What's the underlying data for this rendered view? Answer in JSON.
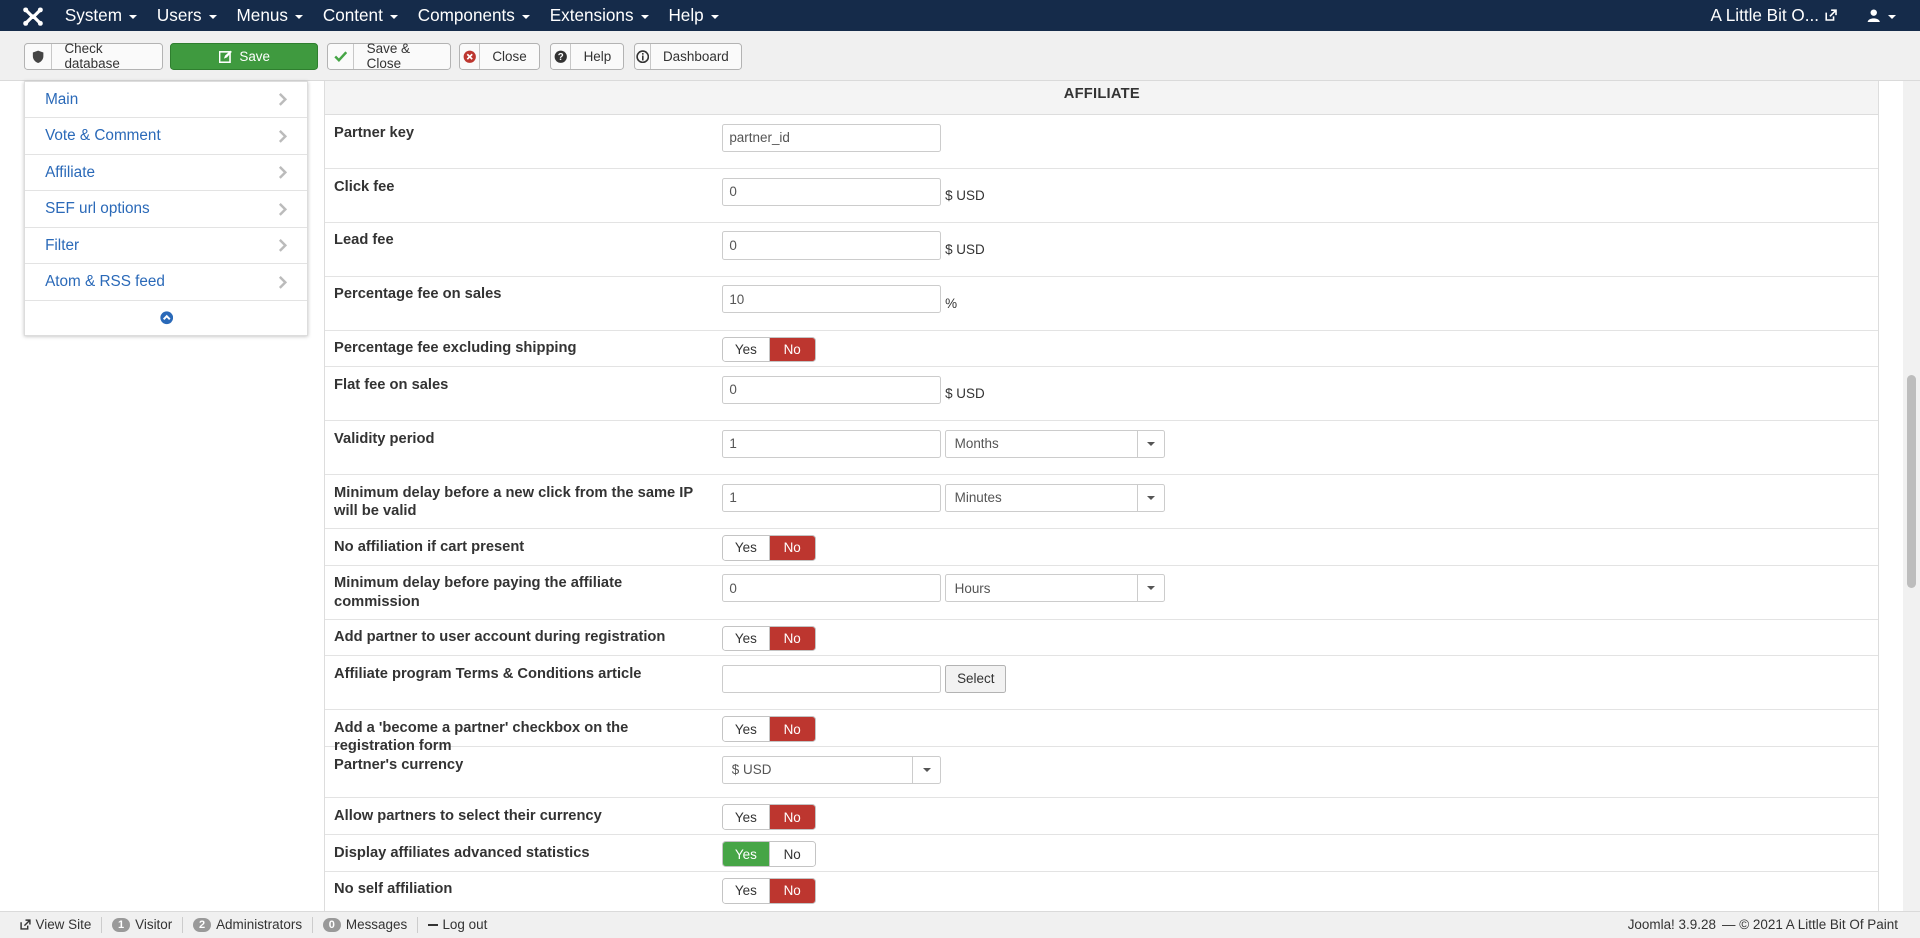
{
  "navbar": {
    "menu": [
      "System",
      "Users",
      "Menus",
      "Content",
      "Components",
      "Extensions",
      "Help"
    ],
    "site_name": "A Little Bit O..."
  },
  "toolbar": {
    "check_database": "Check database",
    "save": "Save",
    "save_close": "Save & Close",
    "close": "Close",
    "help": "Help",
    "dashboard": "Dashboard"
  },
  "sidebar": {
    "items": [
      "Main",
      "Vote & Comment",
      "Affiliate",
      "SEF url options",
      "Filter",
      "Atom & RSS feed"
    ]
  },
  "panel": {
    "title": "AFFILIATE",
    "rows": {
      "partner_key": {
        "label": "Partner key",
        "value": "partner_id"
      },
      "click_fee": {
        "label": "Click fee",
        "value": "0",
        "suffix": "$ USD"
      },
      "lead_fee": {
        "label": "Lead fee",
        "value": "0",
        "suffix": "$ USD"
      },
      "pct_fee": {
        "label": "Percentage fee on sales",
        "value": "10",
        "suffix": "%"
      },
      "pct_excl_shipping": {
        "label": "Percentage fee excluding shipping",
        "yes": "Yes",
        "no": "No",
        "selected": "No"
      },
      "flat_fee": {
        "label": "Flat fee on sales",
        "value": "0",
        "suffix": "$ USD"
      },
      "validity": {
        "label": "Validity period",
        "value": "1",
        "unit": "Months"
      },
      "min_delay_click": {
        "label": "Minimum delay before a new click from the same IP will be valid",
        "value": "1",
        "unit": "Minutes"
      },
      "no_aff_cart": {
        "label": "No affiliation if cart present",
        "yes": "Yes",
        "no": "No",
        "selected": "No"
      },
      "min_delay_pay": {
        "label": "Minimum delay before paying the affiliate commission",
        "value": "0",
        "unit": "Hours"
      },
      "add_partner_reg": {
        "label": "Add partner to user account during registration",
        "yes": "Yes",
        "no": "No",
        "selected": "No"
      },
      "terms_article": {
        "label": "Affiliate program Terms & Conditions article",
        "value": "",
        "button": "Select"
      },
      "become_partner_cb": {
        "label": "Add a 'become a partner' checkbox on the registration form",
        "yes": "Yes",
        "no": "No",
        "selected": "No"
      },
      "partner_currency": {
        "label": "Partner's currency",
        "value": "$ USD"
      },
      "allow_select_currency": {
        "label": "Allow partners to select their currency",
        "yes": "Yes",
        "no": "No",
        "selected": "No"
      },
      "adv_stats": {
        "label": "Display affiliates advanced statistics",
        "yes": "Yes",
        "no": "No",
        "selected": "Yes"
      },
      "no_self_aff": {
        "label": "No self affiliation",
        "yes": "Yes",
        "no": "No",
        "selected": "No"
      }
    }
  },
  "statusbar": {
    "view_site": "View Site",
    "visitor_count": "1",
    "visitor_label": "Visitor",
    "admin_count": "2",
    "admin_label": "Administrators",
    "message_count": "0",
    "message_label": "Messages",
    "logout": "Log out",
    "version": "Joomla! 3.9.28",
    "copyright": "— © 2021 A Little Bit Of Paint"
  },
  "colors": {
    "navbar_bg": "#152b4a",
    "save_green": "#3f9a3f",
    "toggle_no_red": "#bd362f",
    "toggle_yes_green": "#46a546",
    "link_blue": "#2a69b8"
  }
}
